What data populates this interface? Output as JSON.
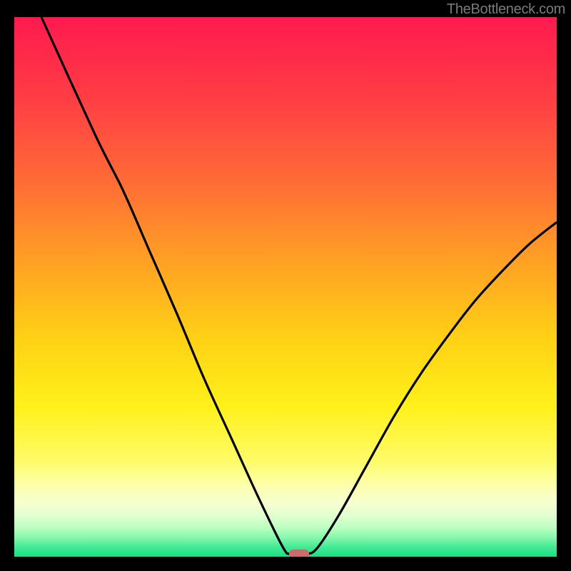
{
  "attribution": "TheBottleneck.com",
  "chart_data": {
    "type": "line",
    "title": "",
    "xlabel": "",
    "ylabel": "",
    "xlim": [
      0,
      100
    ],
    "ylim": [
      0,
      100
    ],
    "curve": {
      "name": "bottleneck-curve",
      "points": [
        {
          "x": 5,
          "y": 100
        },
        {
          "x": 15,
          "y": 78
        },
        {
          "x": 20,
          "y": 68
        },
        {
          "x": 25,
          "y": 56.5
        },
        {
          "x": 30,
          "y": 45
        },
        {
          "x": 35,
          "y": 33
        },
        {
          "x": 40,
          "y": 22
        },
        {
          "x": 45,
          "y": 11
        },
        {
          "x": 49.5,
          "y": 1.8
        },
        {
          "x": 51,
          "y": 0.5
        },
        {
          "x": 54,
          "y": 0.5
        },
        {
          "x": 56,
          "y": 1.8
        },
        {
          "x": 60,
          "y": 8
        },
        {
          "x": 65,
          "y": 17
        },
        {
          "x": 70,
          "y": 26
        },
        {
          "x": 75,
          "y": 34
        },
        {
          "x": 80,
          "y": 41
        },
        {
          "x": 85,
          "y": 47.5
        },
        {
          "x": 90,
          "y": 53
        },
        {
          "x": 95,
          "y": 58
        },
        {
          "x": 100,
          "y": 62
        }
      ]
    },
    "marker": {
      "x": 52.5,
      "y": 0.5,
      "color_hex": "#cf6a6a"
    },
    "gradient_stops": [
      {
        "offset": 0.0,
        "color": "#ff1a4e"
      },
      {
        "offset": 0.15,
        "color": "#ff3d44"
      },
      {
        "offset": 0.3,
        "color": "#ff6a36"
      },
      {
        "offset": 0.45,
        "color": "#ffa024"
      },
      {
        "offset": 0.6,
        "color": "#ffd215"
      },
      {
        "offset": 0.72,
        "color": "#fff01a"
      },
      {
        "offset": 0.82,
        "color": "#fffb66"
      },
      {
        "offset": 0.865,
        "color": "#fdffa9"
      },
      {
        "offset": 0.9,
        "color": "#f6ffd0"
      },
      {
        "offset": 0.925,
        "color": "#e0ffd0"
      },
      {
        "offset": 0.947,
        "color": "#b8ffc0"
      },
      {
        "offset": 0.965,
        "color": "#84f7ac"
      },
      {
        "offset": 0.982,
        "color": "#43eb95"
      },
      {
        "offset": 1.0,
        "color": "#17e085"
      }
    ]
  }
}
